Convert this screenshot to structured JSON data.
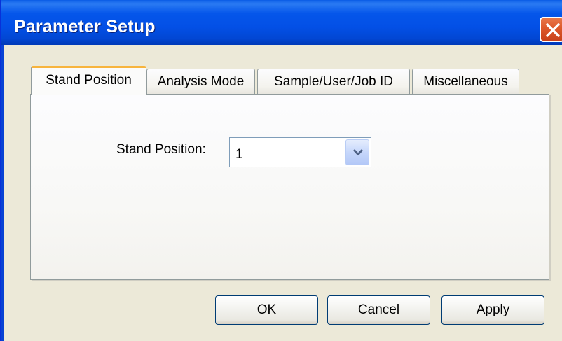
{
  "window": {
    "title": "Parameter Setup"
  },
  "tabs": [
    {
      "label": "Stand Position",
      "active": true
    },
    {
      "label": "Analysis Mode",
      "active": false
    },
    {
      "label": "Sample/User/Job ID",
      "active": false
    },
    {
      "label": "Miscellaneous",
      "active": false
    }
  ],
  "stand_position": {
    "label": "Stand Position:",
    "selected_value": "1"
  },
  "buttons": {
    "ok": "OK",
    "cancel": "Cancel",
    "apply": "Apply"
  },
  "colors": {
    "titlebar": "#0350e6",
    "close_button": "#de5a2c",
    "active_tab_accent": "#f7b43d",
    "dialog_background": "#ece9d8"
  },
  "icons": {
    "close": "close-icon",
    "dropdown": "chevron-down-icon"
  }
}
